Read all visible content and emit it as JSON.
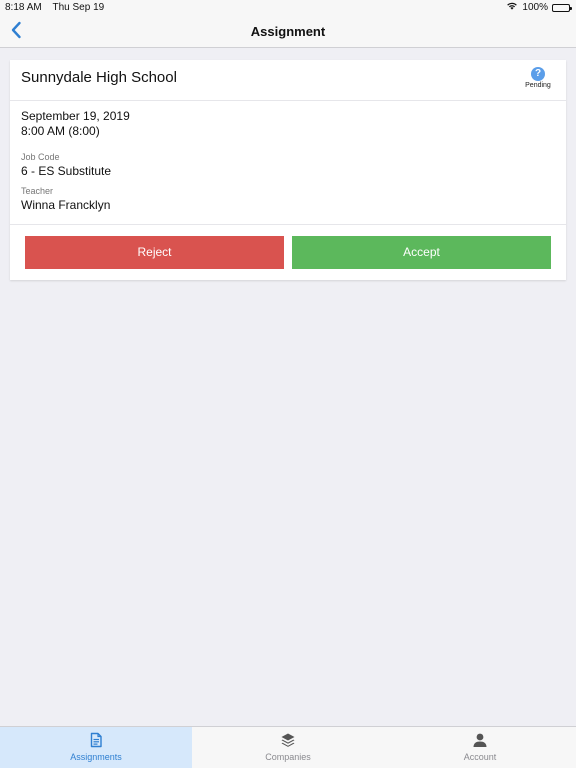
{
  "status_bar": {
    "time": "8:18 AM",
    "date": "Thu Sep 19",
    "battery": "100%",
    "wifi_icon": "wifi-icon",
    "battery_icon": "battery-icon"
  },
  "nav": {
    "title": "Assignment",
    "back_icon": "chevron-left-icon"
  },
  "assignment": {
    "school": "Sunnydale High School",
    "status": "Pending",
    "status_icon": "help-icon",
    "date": "September 19, 2019",
    "time": "8:00 AM (8:00)",
    "job_code_label": "Job Code",
    "job_code": "6 - ES Substitute",
    "teacher_label": "Teacher",
    "teacher": "Winna Francklyn"
  },
  "actions": {
    "reject_label": "Reject",
    "accept_label": "Accept"
  },
  "tabs": [
    {
      "label": "Assignments",
      "icon": "document-icon",
      "active": true
    },
    {
      "label": "Companies",
      "icon": "layers-icon",
      "active": false
    },
    {
      "label": "Account",
      "icon": "person-icon",
      "active": false
    }
  ],
  "colors": {
    "accent": "#2f7fd1",
    "reject": "#d9534f",
    "accept": "#5cb85c",
    "pending_icon": "#5b9ee9",
    "background": "#efeff4"
  }
}
